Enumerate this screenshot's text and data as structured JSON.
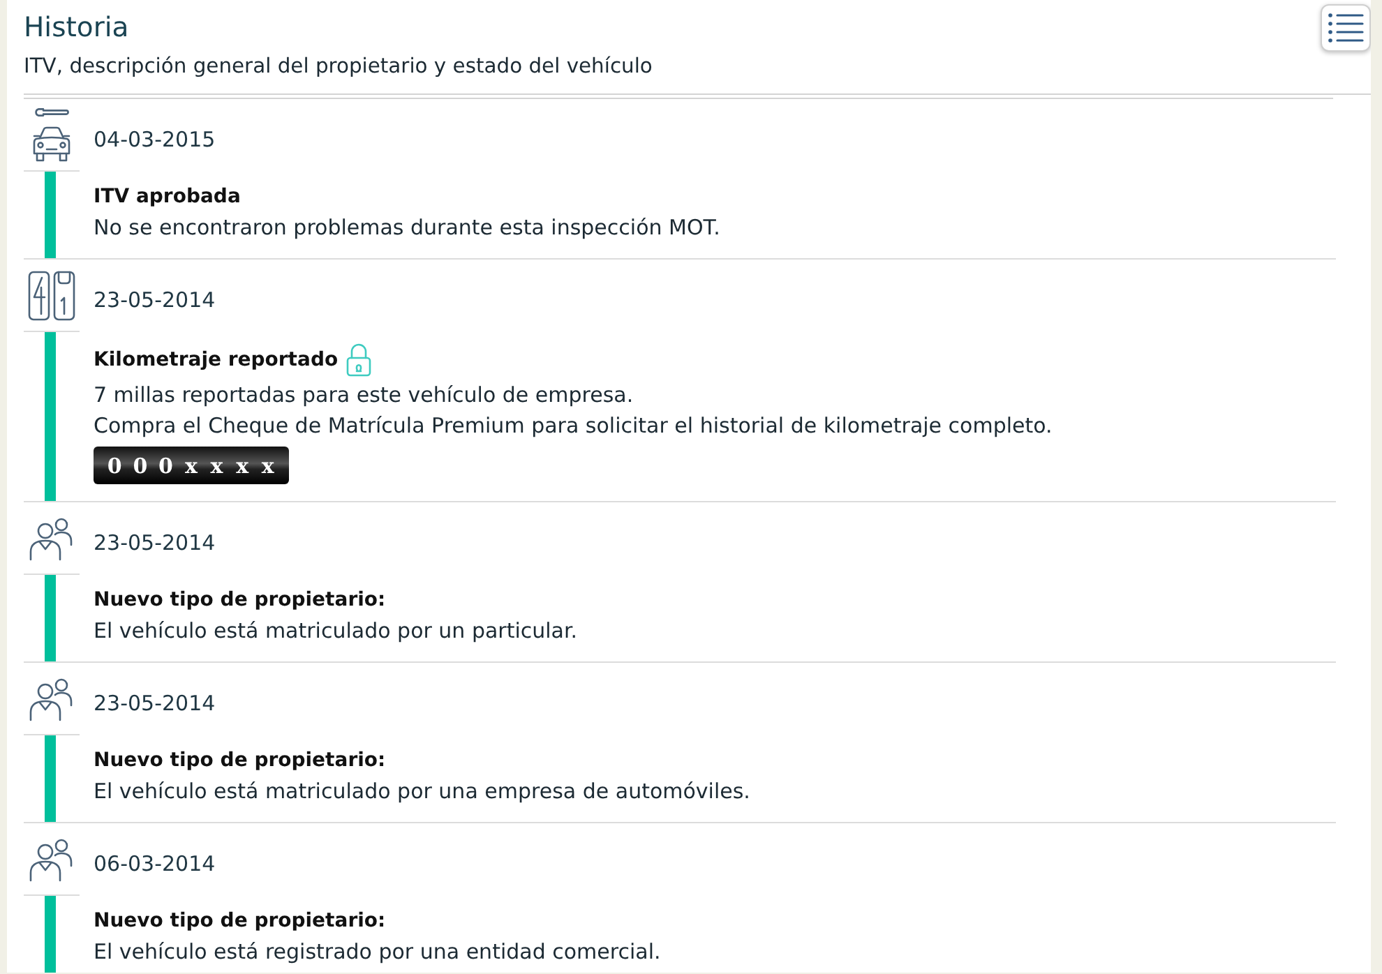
{
  "header": {
    "title": "Historia",
    "subtitle": "ITV, descripción general del propietario y estado del vehículo"
  },
  "events": [
    {
      "kind": "inspection",
      "date": "04-03-2015",
      "title": "ITV aprobada",
      "locked": false,
      "description": [
        "No se encontraron problemas durante esta inspección MOT."
      ]
    },
    {
      "kind": "mileage",
      "date": "23-05-2014",
      "title": "Kilometraje reportado",
      "locked": true,
      "description": [
        "7 millas reportadas para este vehículo de empresa.",
        "Compra el Cheque de Matrícula Premium para solicitar el historial de kilometraje completo."
      ],
      "odometer": [
        "0",
        "0",
        "0",
        "x",
        "x",
        "x",
        "x"
      ]
    },
    {
      "kind": "owner",
      "date": "23-05-2014",
      "title": "Nuevo tipo de propietario:",
      "locked": false,
      "description": [
        "El vehículo está matriculado por un particular."
      ]
    },
    {
      "kind": "owner",
      "date": "23-05-2014",
      "title": "Nuevo tipo de propietario:",
      "locked": false,
      "description": [
        "El vehículo está matriculado por una empresa de automóviles."
      ]
    },
    {
      "kind": "owner",
      "date": "06-03-2014",
      "title": "Nuevo tipo de propietario:",
      "locked": false,
      "description": [
        "El vehículo está registrado por una entidad comercial."
      ]
    }
  ]
}
